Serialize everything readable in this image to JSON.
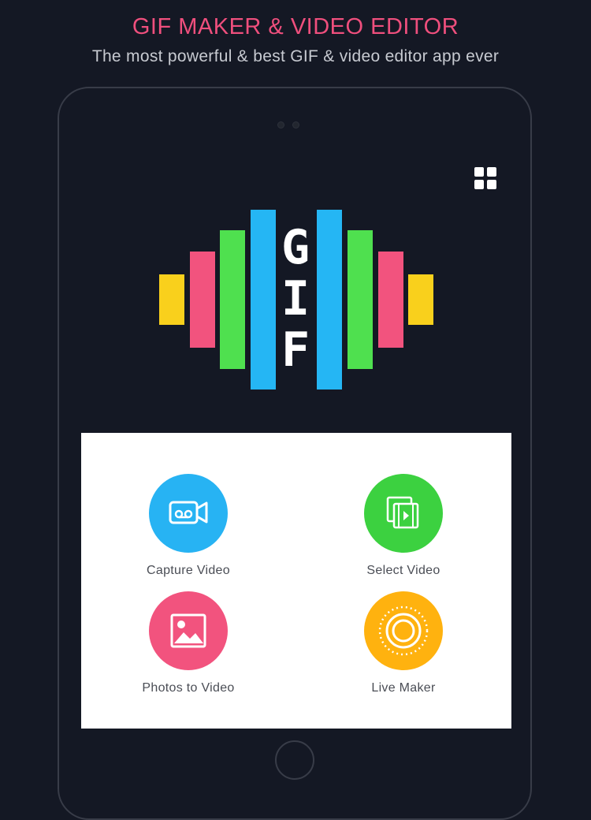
{
  "header": {
    "title": "GIF MAKER & VIDEO EDITOR",
    "subtitle": "The most powerful & best GIF & video editor app ever"
  },
  "logo": {
    "letters": [
      "G",
      "I",
      "F"
    ],
    "colors": {
      "yellow": "#f9d01c",
      "pink": "#f2537e",
      "green": "#4fe04f",
      "blue": "#25b6f4"
    }
  },
  "menu": {
    "icon": "grid-menu-icon"
  },
  "actions": [
    {
      "label": "Capture Video",
      "icon": "video-camera-icon",
      "color": "#27b3f3"
    },
    {
      "label": "Select Video",
      "icon": "film-select-icon",
      "color": "#3cd140"
    },
    {
      "label": "Photos to Video",
      "icon": "image-icon",
      "color": "#f2537e"
    },
    {
      "label": "Live Maker",
      "icon": "live-ring-icon",
      "color": "#ffb20f"
    }
  ],
  "theme": {
    "background": "#141824",
    "accent": "#ef4f7d"
  }
}
